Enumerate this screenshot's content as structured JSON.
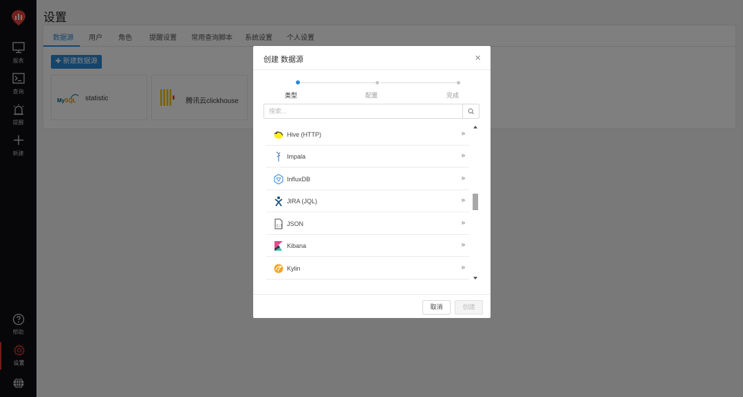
{
  "sidebar": {
    "items": [
      {
        "label": "报表",
        "icon": "monitor-icon"
      },
      {
        "label": "查询",
        "icon": "terminal-icon"
      },
      {
        "label": "提醒",
        "icon": "alarm-icon"
      },
      {
        "label": "新建",
        "icon": "plus-icon"
      },
      {
        "label": "帮助",
        "icon": "help-icon"
      },
      {
        "label": "设置",
        "icon": "gear-icon"
      }
    ],
    "active": "设置"
  },
  "page": {
    "title": "设置",
    "tabs": [
      "数据源",
      "用户",
      "角色",
      "提醒设置",
      "常用查询脚本",
      "系统设置",
      "个人设置"
    ],
    "active_tab": "数据源",
    "new_button": "新建数据源",
    "cards": [
      {
        "name": "statistic",
        "logo": "mysql-logo"
      },
      {
        "name": "腾讯云clickhouse",
        "logo": "clickhouse-logo"
      }
    ]
  },
  "modal": {
    "title": "创建 数据源",
    "steps": [
      {
        "label": "类型",
        "active": true
      },
      {
        "label": "配置",
        "active": false
      },
      {
        "label": "完成",
        "active": false
      }
    ],
    "search_placeholder": "搜索...",
    "items": [
      {
        "label": "Hive (HTTP)",
        "icon": "hive-icon"
      },
      {
        "label": "Impala",
        "icon": "impala-icon"
      },
      {
        "label": "InfluxDB",
        "icon": "influxdb-icon"
      },
      {
        "label": "JIRA (JQL)",
        "icon": "jira-icon"
      },
      {
        "label": "JSON",
        "icon": "json-icon"
      },
      {
        "label": "Kibana",
        "icon": "kibana-icon"
      },
      {
        "label": "Kylin",
        "icon": "kylin-icon"
      }
    ],
    "arrow": "»",
    "cancel": "取消",
    "create": "创建"
  },
  "colors": {
    "accent": "#2a8ad6",
    "sidebar_bg": "#0e0f12",
    "active_nav": "#e53b2c"
  }
}
